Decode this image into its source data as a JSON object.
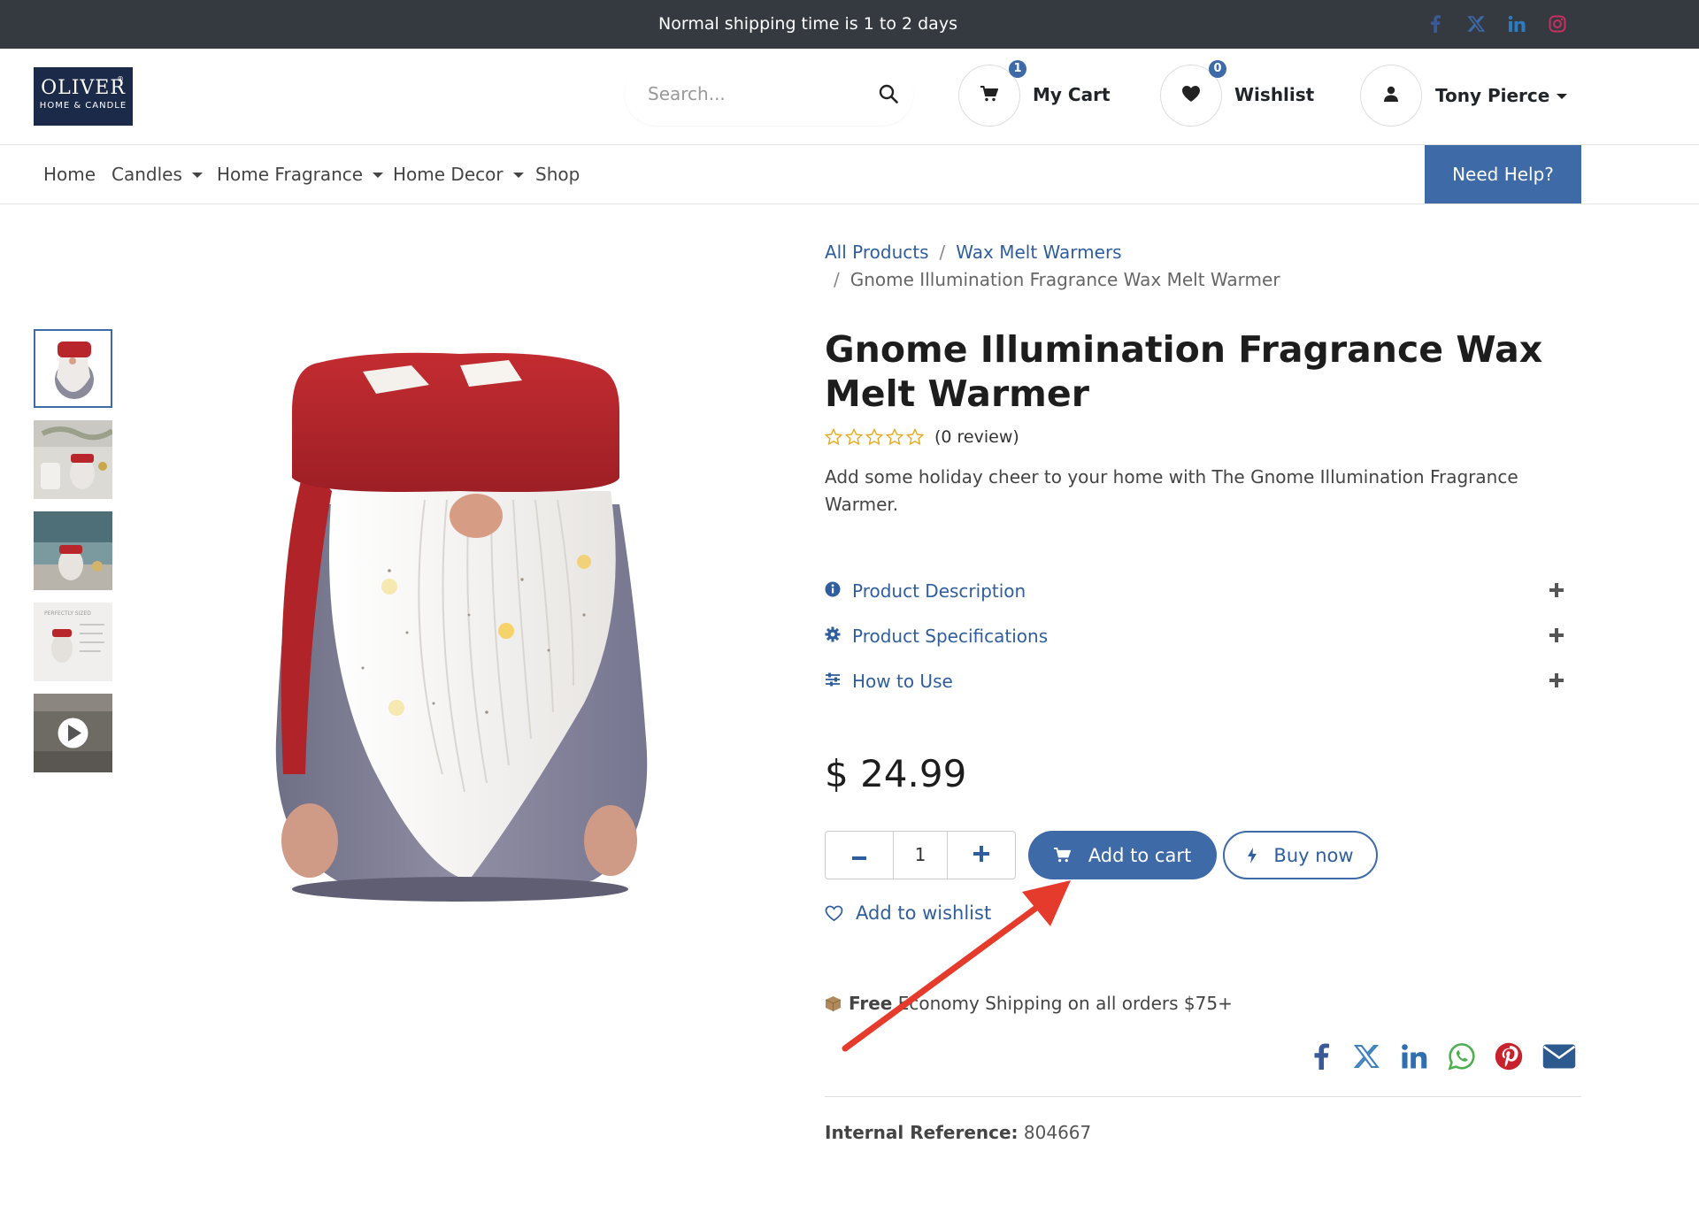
{
  "topbar": {
    "message": "Normal shipping time is 1 to 2 days",
    "social": [
      "facebook-icon",
      "x-icon",
      "linkedin-icon",
      "instagram-icon"
    ]
  },
  "header": {
    "logo_line1": "OLIVER",
    "logo_line2": "HOME & CANDLE",
    "search_placeholder": "Search...",
    "cart_count": "1",
    "cart_label": "My Cart",
    "wishlist_count": "0",
    "wishlist_label": "Wishlist",
    "user_name": "Tony Pierce"
  },
  "nav": {
    "items": [
      {
        "label": "Home",
        "dropdown": false
      },
      {
        "label": "Candles",
        "dropdown": true
      },
      {
        "label": "Home Fragrance",
        "dropdown": true
      },
      {
        "label": "Home Decor",
        "dropdown": true
      },
      {
        "label": "Shop",
        "dropdown": false
      }
    ],
    "help_label": "Need Help?"
  },
  "breadcrumb": {
    "items": [
      "All Products",
      "Wax Melt Warmers"
    ],
    "current": "Gnome Illumination Fragrance Wax Melt Warmer"
  },
  "product": {
    "title": "Gnome Illumination Fragrance Wax Melt Warmer",
    "rating_stars": 0,
    "rating_max": 5,
    "review_text": "(0 review)",
    "description": "Add some holiday cheer to your home with The Gnome Illumination Fragrance Warmer.",
    "accordion": [
      {
        "label": "Product Description",
        "icon": "info-icon"
      },
      {
        "label": "Product Specifications",
        "icon": "gear-icon"
      },
      {
        "label": "How to Use",
        "icon": "sliders-icon"
      }
    ],
    "price": "$ 24.99",
    "quantity": "1",
    "add_to_cart": "Add to cart",
    "buy_now": "Buy now",
    "add_to_wishlist": "Add to wishlist",
    "shipping_bold": "Free",
    "shipping_text": " Economy Shipping on all orders $75+",
    "internal_ref_label": "Internal Reference:",
    "internal_ref_value": " 804667"
  },
  "share_icons": [
    "facebook-icon",
    "x-icon",
    "linkedin-icon",
    "whatsapp-icon",
    "pinterest-icon",
    "email-icon"
  ],
  "colors": {
    "accent": "#3e6aa8",
    "topbar": "#343a40",
    "annotation_arrow": "#e53b2c"
  }
}
